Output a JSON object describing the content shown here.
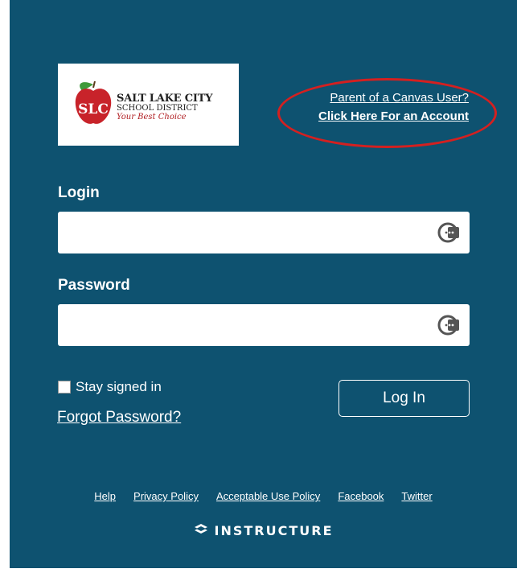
{
  "logo": {
    "line1": "SALT LAKE CITY",
    "line2": "SCHOOL DISTRICT",
    "line3": "Your Best Choice",
    "initials": "SLC"
  },
  "parent": {
    "line1": "Parent of a Canvas User?",
    "line2": "Click Here For an Account"
  },
  "login": {
    "label": "Login",
    "value": "",
    "icon": "password-manager-icon"
  },
  "password": {
    "label": "Password",
    "value": "",
    "icon": "password-manager-icon"
  },
  "stay_signed_in": {
    "label": "Stay signed in",
    "checked": false
  },
  "forgot_password": "Forgot Password?",
  "login_button": "Log In",
  "footer": {
    "links": [
      "Help",
      "Privacy Policy",
      "Acceptable Use Policy",
      "Facebook",
      "Twitter"
    ],
    "brand": "INSTRUCTURE"
  },
  "colors": {
    "background": "#0e5270",
    "annotation_ring": "#d42020",
    "logo_accent": "#b01e22"
  }
}
